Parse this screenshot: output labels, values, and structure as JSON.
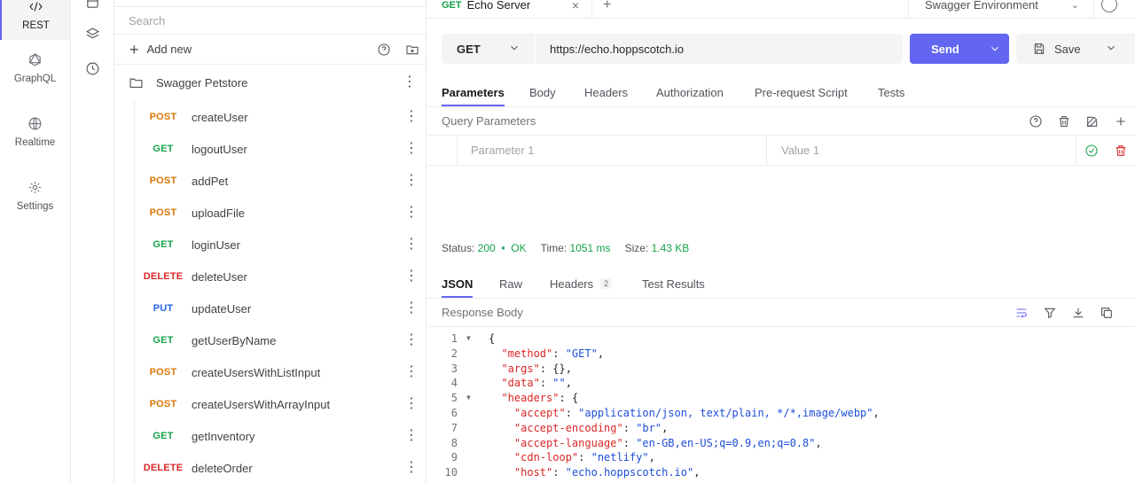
{
  "nav": {
    "items": [
      {
        "label": "REST",
        "icon": "rest-icon"
      },
      {
        "label": "GraphQL",
        "icon": "graphql-icon"
      },
      {
        "label": "Realtime",
        "icon": "globe-icon"
      },
      {
        "label": "Settings",
        "icon": "gear-icon"
      }
    ]
  },
  "collections": {
    "search_placeholder": "Search",
    "add_new_label": "Add new",
    "folder_name": "Swagger Petstore",
    "requests": [
      {
        "method": "POST",
        "name": "createUser"
      },
      {
        "method": "GET",
        "name": "logoutUser"
      },
      {
        "method": "POST",
        "name": "addPet"
      },
      {
        "method": "POST",
        "name": "uploadFile"
      },
      {
        "method": "GET",
        "name": "loginUser"
      },
      {
        "method": "DELETE",
        "name": "deleteUser"
      },
      {
        "method": "PUT",
        "name": "updateUser"
      },
      {
        "method": "GET",
        "name": "getUserByName"
      },
      {
        "method": "POST",
        "name": "createUsersWithListInput"
      },
      {
        "method": "POST",
        "name": "createUsersWithArrayInput"
      },
      {
        "method": "GET",
        "name": "getInventory"
      },
      {
        "method": "DELETE",
        "name": "deleteOrder"
      }
    ]
  },
  "method_colors": {
    "GET": "#16a34a",
    "POST": "#d97706",
    "PUT": "#2563eb",
    "DELETE": "#dc2626"
  },
  "tabs": {
    "active_method": "GET",
    "active_title": "Echo Server",
    "close_glyph": "×",
    "new_tab_glyph": "+"
  },
  "environment": {
    "label": "Swagger Environment"
  },
  "request": {
    "method": "GET",
    "url": "https://echo.hoppscotch.io",
    "send_label": "Send",
    "save_label": "Save"
  },
  "request_tabs": [
    "Parameters",
    "Body",
    "Headers",
    "Authorization",
    "Pre-request Script",
    "Tests"
  ],
  "query_params": {
    "title": "Query Parameters",
    "param_placeholder": "Parameter 1",
    "value_placeholder": "Value 1"
  },
  "response": {
    "status_label": "Status:",
    "status_code": "200",
    "status_sep": "•",
    "status_text": "OK",
    "time_label": "Time:",
    "time_value": "1051 ms",
    "size_label": "Size:",
    "size_value": "1.43 KB",
    "tabs": [
      {
        "label": "JSON"
      },
      {
        "label": "Raw"
      },
      {
        "label": "Headers",
        "count": "2"
      },
      {
        "label": "Test Results"
      }
    ],
    "body_title": "Response Body",
    "lines": [
      {
        "n": "1",
        "fold": true,
        "indent": "",
        "key": "",
        "sep": "",
        "val": "",
        "tail": "{"
      },
      {
        "n": "2",
        "fold": false,
        "indent": "  ",
        "key": "\"method\"",
        "sep": ": ",
        "val": "\"GET\"",
        "tail": ","
      },
      {
        "n": "3",
        "fold": false,
        "indent": "  ",
        "key": "\"args\"",
        "sep": ": ",
        "val": "",
        "tail": "{},"
      },
      {
        "n": "4",
        "fold": false,
        "indent": "  ",
        "key": "\"data\"",
        "sep": ": ",
        "val": "\"\"",
        "tail": ","
      },
      {
        "n": "5",
        "fold": true,
        "indent": "  ",
        "key": "\"headers\"",
        "sep": ": ",
        "val": "",
        "tail": "{"
      },
      {
        "n": "6",
        "fold": false,
        "indent": "    ",
        "key": "\"accept\"",
        "sep": ": ",
        "val": "\"application/json, text/plain, */*,image/webp\"",
        "tail": ","
      },
      {
        "n": "7",
        "fold": false,
        "indent": "    ",
        "key": "\"accept-encoding\"",
        "sep": ": ",
        "val": "\"br\"",
        "tail": ","
      },
      {
        "n": "8",
        "fold": false,
        "indent": "    ",
        "key": "\"accept-language\"",
        "sep": ": ",
        "val": "\"en-GB,en-US;q=0.9,en;q=0.8\"",
        "tail": ","
      },
      {
        "n": "9",
        "fold": false,
        "indent": "    ",
        "key": "\"cdn-loop\"",
        "sep": ": ",
        "val": "\"netlify\"",
        "tail": ","
      },
      {
        "n": "10",
        "fold": false,
        "indent": "    ",
        "key": "\"host\"",
        "sep": ": ",
        "val": "\"echo.hoppscotch.io\"",
        "tail": ","
      }
    ]
  },
  "accent_color": "#6366f1"
}
